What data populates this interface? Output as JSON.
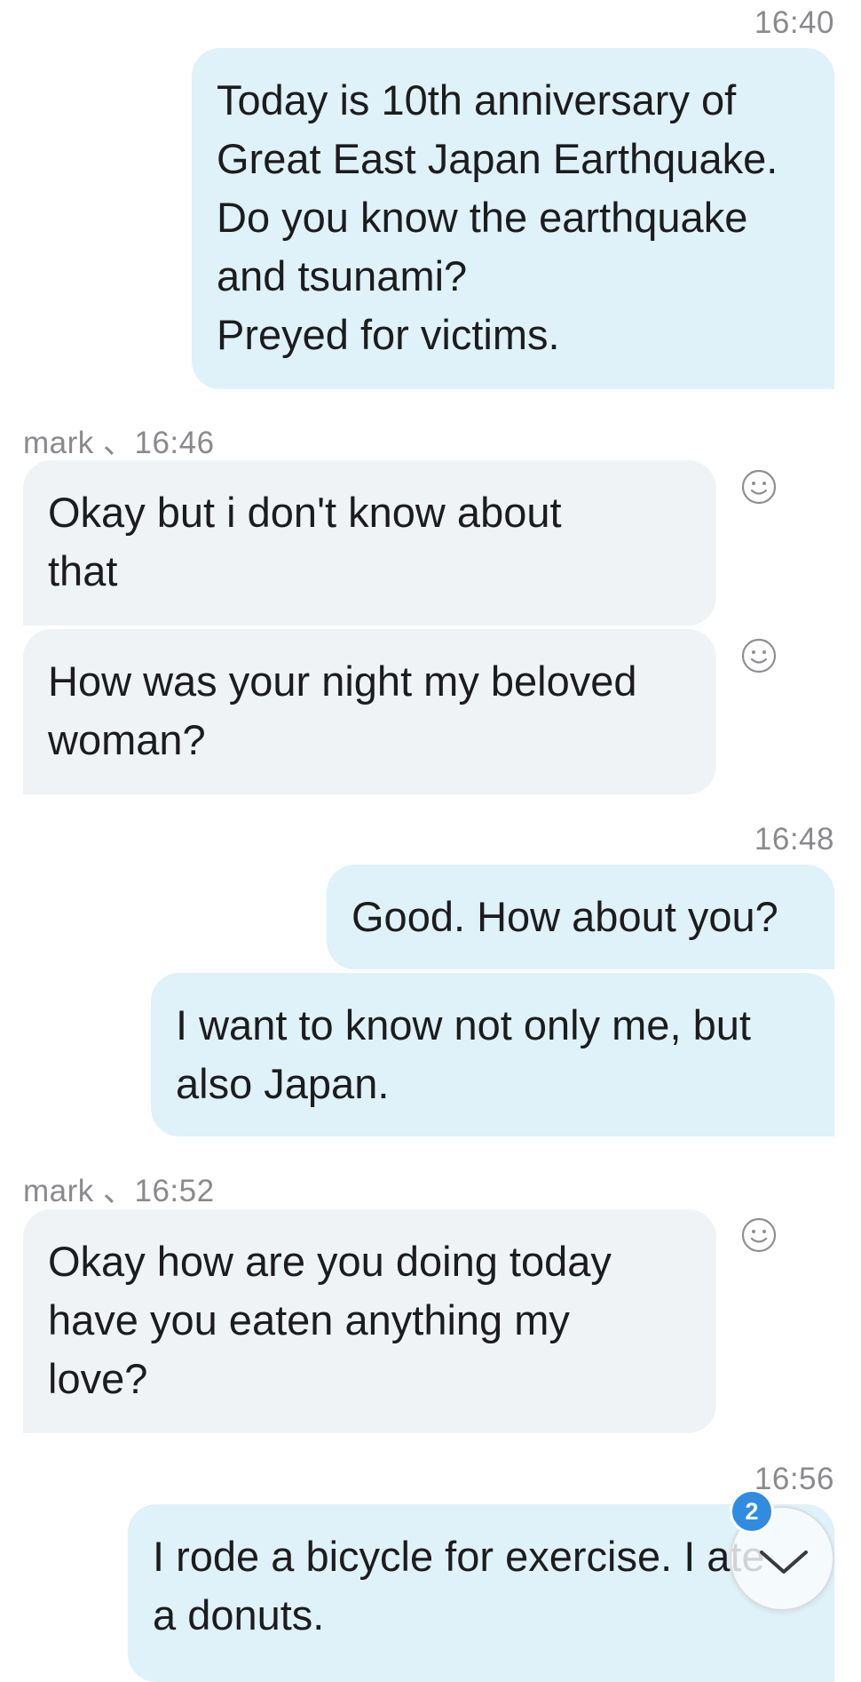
{
  "messages": [
    {
      "id": "m1",
      "direction": "outgoing",
      "timestamp": "16:40",
      "text": "Today is 10th anniversary of\nGreat East Japan Earthquake.\nDo you know the earthquake\nand tsunami?\nPreyed for victims."
    },
    {
      "id": "m2",
      "direction": "incoming",
      "sender": "mark",
      "timestamp": "16:46",
      "header": "mark 、16:46",
      "text": "Okay but i don't know about\nthat",
      "reaction_icon": "smiley-face-icon"
    },
    {
      "id": "m3",
      "direction": "incoming",
      "text": "How was your night my beloved\nwoman?",
      "reaction_icon": "smiley-face-icon"
    },
    {
      "id": "m4",
      "direction": "outgoing",
      "timestamp": "16:48",
      "text": "Good. How about you?"
    },
    {
      "id": "m5",
      "direction": "outgoing",
      "text": "I want to know not only me, but\nalso Japan."
    },
    {
      "id": "m6",
      "direction": "incoming",
      "sender": "mark",
      "timestamp": "16:52",
      "header": "mark 、16:52",
      "text": "Okay how are you doing today\nhave you eaten anything my\nlove?",
      "reaction_icon": "smiley-face-icon"
    },
    {
      "id": "m7",
      "direction": "outgoing",
      "timestamp": "16:56",
      "text": "I rode a bicycle for exercise. I ate\na donuts."
    }
  ],
  "scroll_to_bottom": {
    "icon": "chevron-down-icon",
    "unread_count": "2",
    "badge_color": "#2f8ce0"
  },
  "colors": {
    "outgoing_bubble": "#dff1f9",
    "incoming_bubble": "#f0f3f6",
    "timestamp_text": "#8a8a8e"
  }
}
